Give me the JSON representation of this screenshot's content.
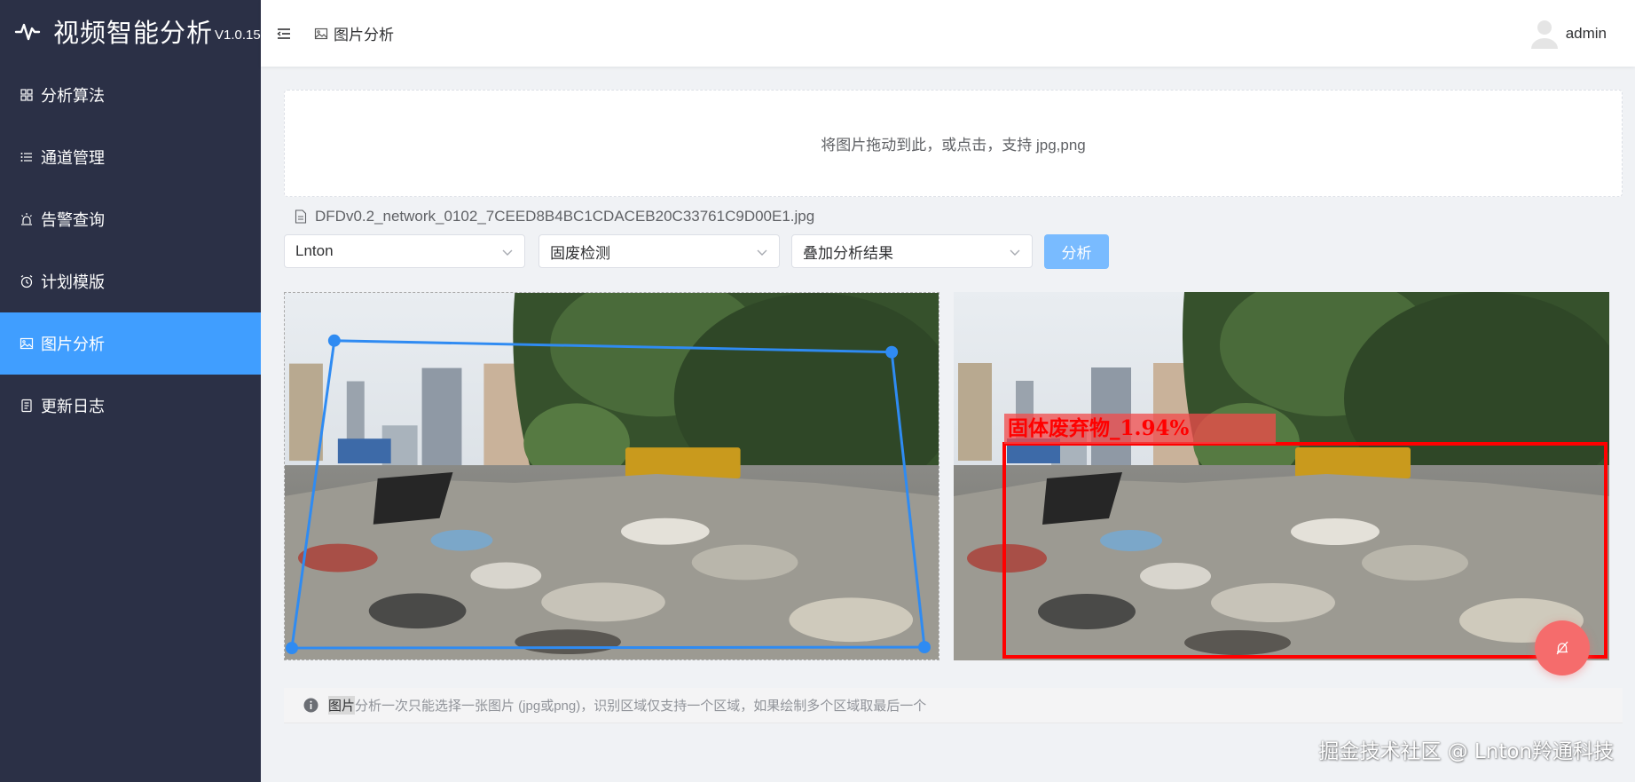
{
  "app": {
    "title": "视频智能分析",
    "version": "V1.0.15"
  },
  "sidebar": {
    "items": [
      {
        "label": "分析算法",
        "icon": "grid-icon"
      },
      {
        "label": "通道管理",
        "icon": "list-icon"
      },
      {
        "label": "告警查询",
        "icon": "alarm-icon"
      },
      {
        "label": "计划模版",
        "icon": "clock-icon"
      },
      {
        "label": "图片分析",
        "icon": "picture-icon",
        "active": true
      },
      {
        "label": "更新日志",
        "icon": "document-icon"
      }
    ]
  },
  "header": {
    "breadcrumb": "图片分析",
    "user": "admin"
  },
  "upload": {
    "text": "将图片拖动到此，或点击，支持 jpg,png"
  },
  "file": {
    "name": "DFDv0.2_network_0102_7CEED8B4BC1CDACEB20C33761C9D00E1.jpg"
  },
  "controls": {
    "channel": "Lnton",
    "algorithm": "固废检测",
    "mode": "叠加分析结果",
    "analyze_label": "分析"
  },
  "result": {
    "label": "固体废弃物_1.94%"
  },
  "tip": {
    "highlight": "图片",
    "text": "分析一次只能选择一张图片 (jpg或png)，识别区域仅支持一个区域，如果绘制多个区域取最后一个"
  },
  "watermark": "掘金技术社区 @ Lnton羚通科技",
  "colors": {
    "sidebar_bg": "#2b3046",
    "accent": "#409eff",
    "detection_box": "#ff0000",
    "fab": "#f56c6c"
  }
}
